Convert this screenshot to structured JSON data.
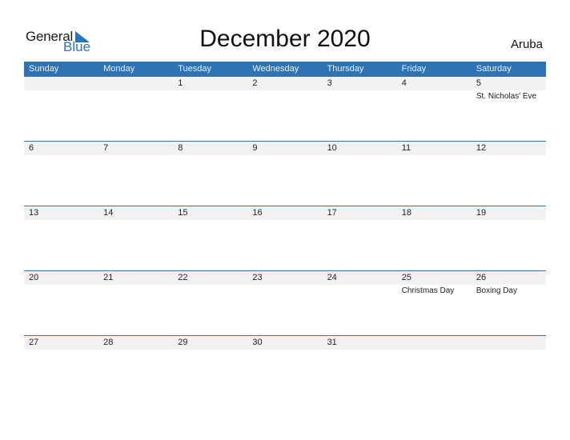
{
  "logo": {
    "general": "General",
    "blue": "Blue"
  },
  "title": "December 2020",
  "country": "Aruba",
  "colors": {
    "accent": "#2e73b4",
    "band": "#f2f2f2"
  },
  "weekdays": [
    "Sunday",
    "Monday",
    "Tuesday",
    "Wednesday",
    "Thursday",
    "Friday",
    "Saturday"
  ],
  "weeks": [
    [
      {
        "d": ""
      },
      {
        "d": ""
      },
      {
        "d": "1"
      },
      {
        "d": "2"
      },
      {
        "d": "3"
      },
      {
        "d": "4"
      },
      {
        "d": "5",
        "h": "St. Nicholas' Eve"
      }
    ],
    [
      {
        "d": "6"
      },
      {
        "d": "7"
      },
      {
        "d": "8"
      },
      {
        "d": "9"
      },
      {
        "d": "10"
      },
      {
        "d": "11"
      },
      {
        "d": "12"
      }
    ],
    [
      {
        "d": "13"
      },
      {
        "d": "14"
      },
      {
        "d": "15"
      },
      {
        "d": "16"
      },
      {
        "d": "17"
      },
      {
        "d": "18"
      },
      {
        "d": "19"
      }
    ],
    [
      {
        "d": "20"
      },
      {
        "d": "21"
      },
      {
        "d": "22"
      },
      {
        "d": "23"
      },
      {
        "d": "24"
      },
      {
        "d": "25",
        "h": "Christmas Day"
      },
      {
        "d": "26",
        "h": "Boxing Day"
      }
    ],
    [
      {
        "d": "27"
      },
      {
        "d": "28"
      },
      {
        "d": "29"
      },
      {
        "d": "30"
      },
      {
        "d": "31"
      },
      {
        "d": ""
      },
      {
        "d": ""
      }
    ]
  ]
}
